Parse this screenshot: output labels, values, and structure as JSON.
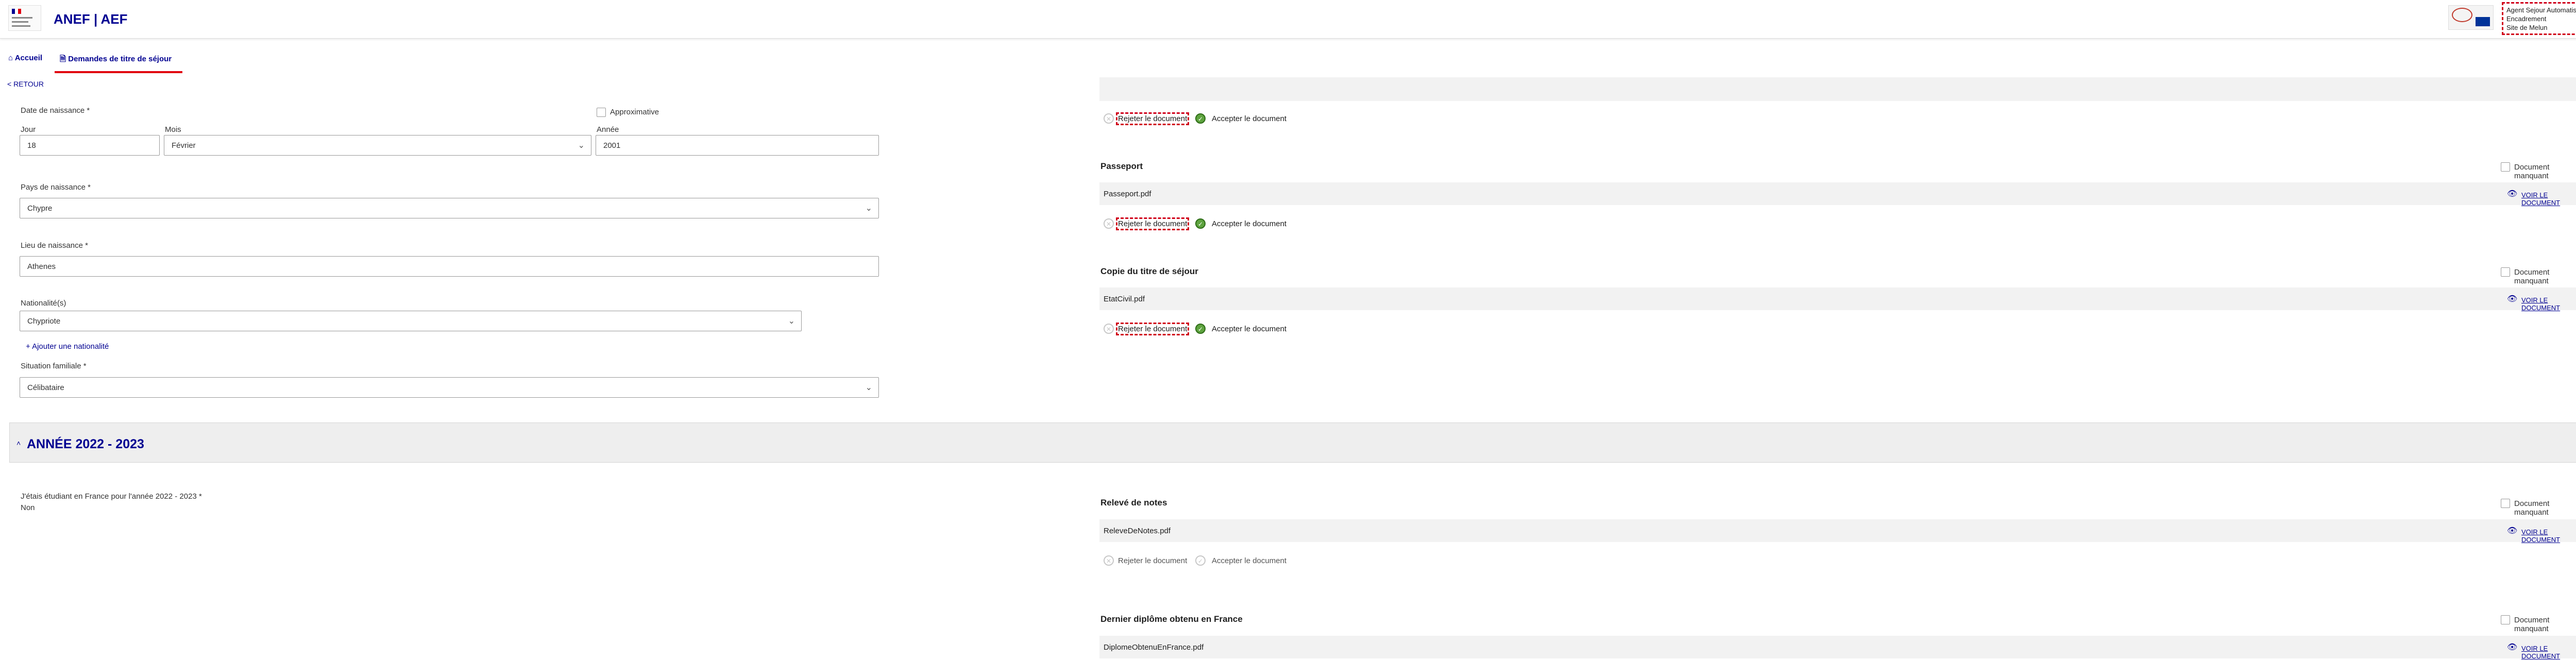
{
  "header": {
    "app_title": "ANEF | AEF",
    "user": {
      "name": "Agent Sejour Automatisation",
      "role": "Encadrement",
      "site": "Site de Melun"
    }
  },
  "nav": {
    "home_label": "Accueil",
    "requests_label": "Demandes de titre de séjour"
  },
  "back_label": "< RETOUR",
  "form": {
    "birth_date_label": "Date de naissance *",
    "approx_label": "Approximative",
    "day_label": "Jour",
    "day_value": "18",
    "month_label": "Mois",
    "month_value": "Février",
    "year_label": "Année",
    "year_value": "2001",
    "birth_country_label": "Pays de naissance *",
    "birth_country_value": "Chypre",
    "birth_place_label": "Lieu de naissance *",
    "birth_place_value": "Athenes",
    "nationality_label": "Nationalité(s)",
    "nationality_value": "Chypriote",
    "add_nationality_label": "+ Ajouter une nationalité",
    "family_status_label": "Situation familiale *",
    "family_status_value": "Célibataire"
  },
  "year_section": {
    "title": "ANNÉE 2022 - 2023",
    "question_label": "J'étais étudiant en France pour l'année 2022 - 2023 *",
    "answer": "Non"
  },
  "documents": {
    "reject_label": "Rejeter le document",
    "accept_label": "Accepter le document",
    "missing_label": "Document manquant",
    "view_label": "VOIR LE DOCUMENT",
    "items": [
      {
        "title": "Passeport",
        "file": "Passeport.pdf"
      },
      {
        "title": "Copie du titre de séjour",
        "file": "EtatCivil.pdf"
      },
      {
        "title": "Relevé de notes",
        "file": "ReleveDeNotes.pdf"
      },
      {
        "title": "Dernier diplôme obtenu en France",
        "file": "DiplomeObtenuEnFrance.pdf"
      }
    ]
  },
  "colors": {
    "brand_blue": "#000091",
    "accent_red": "#e1000f",
    "accept_green": "#5ea33f"
  }
}
